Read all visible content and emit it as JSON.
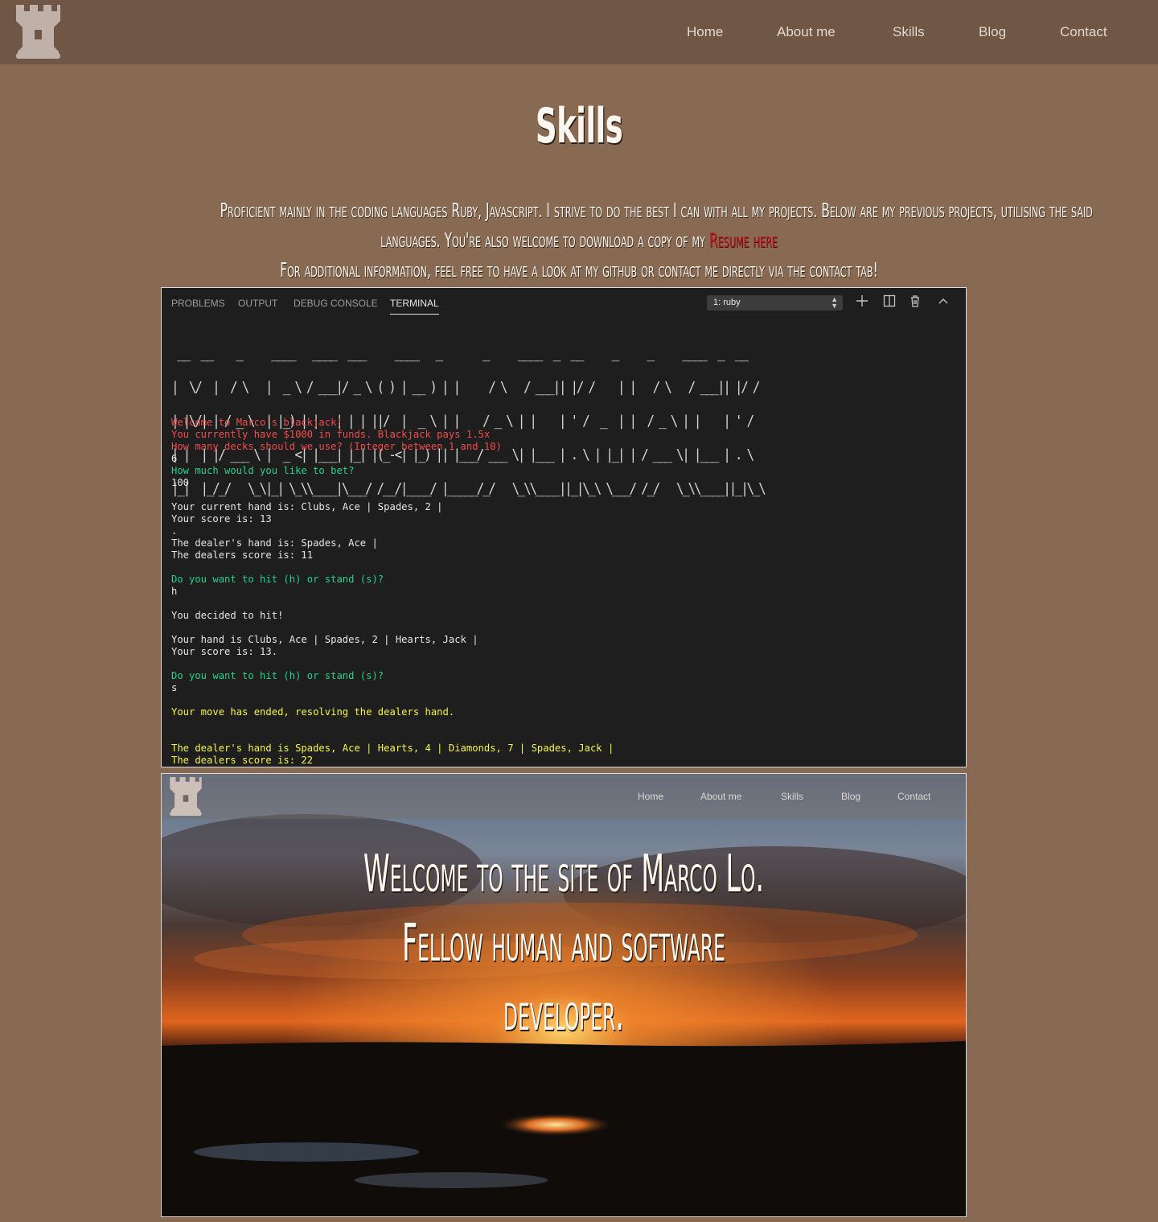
{
  "header": {
    "logo_icon": "castle-rook-icon",
    "nav": [
      "Home",
      "About me",
      "Skills",
      "Blog",
      "Contact"
    ]
  },
  "page_title": "Skills",
  "intro": {
    "line1": "Proficient mainly in the coding languages Ruby, Javascript. I strive to do the best I can with all my projects. Below are my previous projects, utilising the said",
    "line2_text": "languages. You're also welcome to download a copy of my ",
    "resume_link": "Resume here",
    "line3": "For additional information, feel free to have a look at my github or contact me directly via the contact tab!"
  },
  "colors": {
    "background": "#886a52",
    "header": "#6f5645",
    "link": "#c8141a",
    "terminal_red": "#f14c4c",
    "terminal_green": "#23d18b",
    "terminal_yellow": "#f5f543"
  },
  "terminal": {
    "tabs": [
      "PROBLEMS",
      "OUTPUT",
      "DEBUG CONSOLE",
      "TERMINAL"
    ],
    "active_tab": "TERMINAL",
    "shell_select": "1: ruby",
    "icons": [
      "plus-icon",
      "split-icon",
      "trash-icon",
      "chevron-up-icon"
    ],
    "ascii_banner": [
      " __  __    _     ____   ____  ___     ____   _       _     ____  _  __     _     _     ____  _  __",
      "|  \\/  |  / \\   |  _ \\ / ___|/ _ \\ ( ) | __ ) | |     / \\   / ___|| |/ /    | |   / \\   / ___|| |/ /",
      "| |\\/| | / _ \\  | |_) | |   | | | ||/  |  _ \\ | |    / _ \\ | |    | ' /  _  | |  / _ \\ | |    | ' / ",
      "| |  | |/ ___ \\ |  _ <| |___| |_| |(_-<| |_) || |___/ ___ \\| |___ | . \\ | |_| | / ___ \\| |___ | . \\ ",
      "|_|  |_/_/   \\_\\|_| \\_\\\\____|\\___/ /__/|____/ |_____/_/   \\_\\\\____||_|\\_\\ \\___/ /_/   \\_\\\\____||_|\\_\\"
    ],
    "lines": [
      {
        "text": "Welcome to Marco's blackjack!",
        "color": "#f14c4c"
      },
      {
        "text": "You currently have $1000 in funds. Blackjack pays 1.5x",
        "color": "#f14c4c"
      },
      {
        "text": "How many decks should we use? (Integer between 1 and 10)",
        "color": "#f14c4c"
      },
      {
        "text": "6",
        "color": "#e5e5e5"
      },
      {
        "text": "How much would you like to bet?",
        "color": "#23d18b"
      },
      {
        "text": "100",
        "color": "#e5e5e5"
      },
      {
        "text": "",
        "color": "#e5e5e5"
      },
      {
        "text": "Your current hand is: Clubs, Ace | Spades, 2 |",
        "color": "#e5e5e5"
      },
      {
        "text": "Your score is: 13",
        "color": "#e5e5e5"
      },
      {
        "text": ".",
        "color": "#e5e5e5"
      },
      {
        "text": "The dealer's hand is: Spades, Ace |",
        "color": "#e5e5e5"
      },
      {
        "text": "The dealers score is: 11",
        "color": "#e5e5e5"
      },
      {
        "text": "",
        "color": "#e5e5e5"
      },
      {
        "text": "Do you want to hit (h) or stand (s)?",
        "color": "#23d18b"
      },
      {
        "text": "h",
        "color": "#e5e5e5"
      },
      {
        "text": "",
        "color": "#e5e5e5"
      },
      {
        "text": "You decided to hit!",
        "color": "#e5e5e5"
      },
      {
        "text": "",
        "color": "#e5e5e5"
      },
      {
        "text": "Your hand is Clubs, Ace | Spades, 2 | Hearts, Jack |",
        "color": "#e5e5e5"
      },
      {
        "text": "Your score is: 13.",
        "color": "#e5e5e5"
      },
      {
        "text": "",
        "color": "#e5e5e5"
      },
      {
        "text": "Do you want to hit (h) or stand (s)?",
        "color": "#23d18b"
      },
      {
        "text": "s",
        "color": "#e5e5e5"
      },
      {
        "text": "",
        "color": "#e5e5e5"
      },
      {
        "text": "Your move has ended, resolving the dealers hand.",
        "color": "#f5f543"
      },
      {
        "text": "",
        "color": "#e5e5e5"
      },
      {
        "text": "",
        "color": "#e5e5e5"
      },
      {
        "text": "The dealer's hand is Spades, Ace | Hearts, 4 | Diamonds, 7 | Spades, Jack |",
        "color": "#f5f543"
      },
      {
        "text": "The dealers score is: 22",
        "color": "#f5f543"
      }
    ]
  },
  "website_preview": {
    "logo_icon": "castle-rook-icon",
    "nav": [
      "Home",
      "About me",
      "Skills",
      "Blog",
      "Contact"
    ],
    "hero_lines": [
      "Welcome to the site of Marco Lo.",
      "Fellow human and software",
      "developer."
    ]
  }
}
